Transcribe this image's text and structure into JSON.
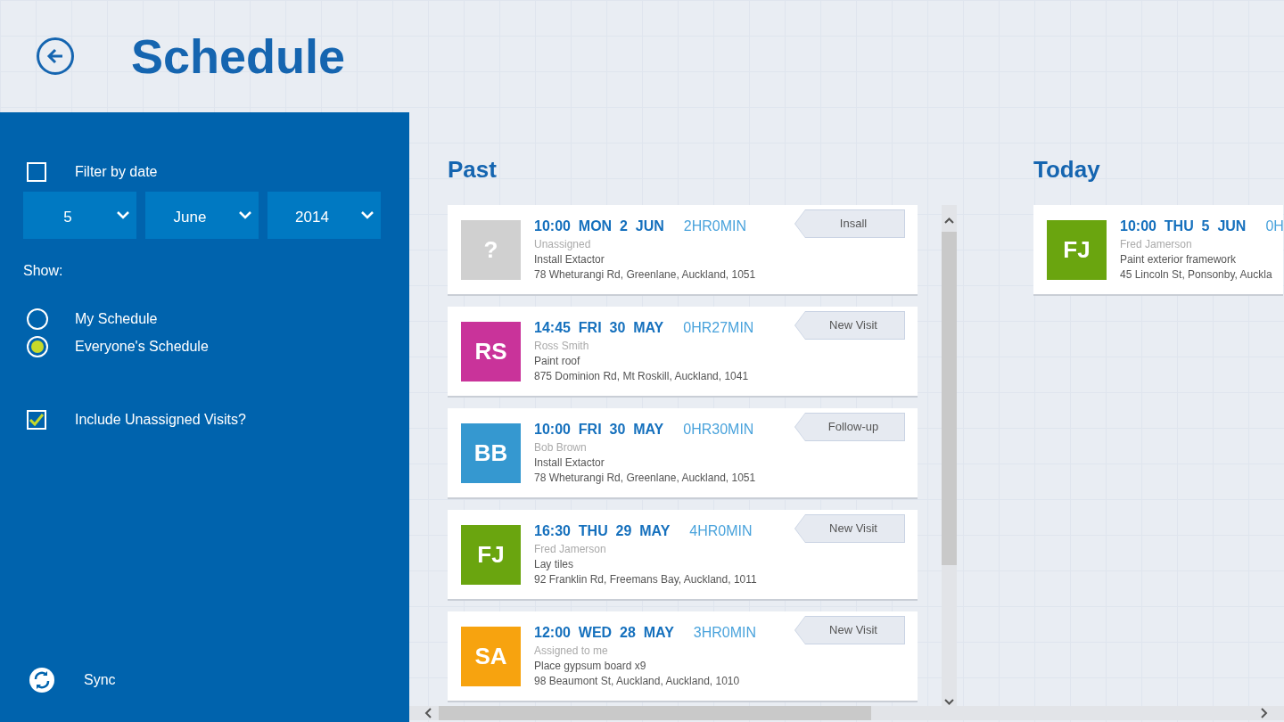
{
  "header": {
    "title": "Schedule"
  },
  "sidebar": {
    "filter_by_date": {
      "label": "Filter by date",
      "checked": false
    },
    "date_selects": [
      {
        "value": "5"
      },
      {
        "value": "June"
      },
      {
        "value": "2014"
      }
    ],
    "show_label": "Show:",
    "show_options": [
      {
        "label": "My Schedule",
        "selected": false
      },
      {
        "label": "Everyone's Schedule",
        "selected": true
      }
    ],
    "include_unassigned": {
      "label": "Include Unassigned Visits?",
      "checked": true
    },
    "sync": {
      "label": "Sync"
    }
  },
  "columns": [
    {
      "title": "Past",
      "visits": [
        {
          "initials": "?",
          "color": "#d0d0d0",
          "time": "10:00  MON  2  JUN",
          "duration": "2HR0MIN",
          "assignee": "Unassigned",
          "task": "Install Extactor",
          "address": "78 Wheturangi Rd, Greenlane, Auckland, 1051",
          "tag": "Insall"
        },
        {
          "initials": "RS",
          "color": "#c9339a",
          "time": "14:45  FRI  30  MAY",
          "duration": "0HR27MIN",
          "assignee": "Ross Smith",
          "task": "Paint roof",
          "address": "875 Dominion Rd, Mt Roskill, Auckland, 1041",
          "tag": "New Visit"
        },
        {
          "initials": "BB",
          "color": "#3598d0",
          "time": "10:00  FRI  30  MAY",
          "duration": "0HR30MIN",
          "assignee": "Bob Brown",
          "task": "Install Extactor",
          "address": "78 Wheturangi Rd, Greenlane, Auckland, 1051",
          "tag": "Follow-up"
        },
        {
          "initials": "FJ",
          "color": "#6aa50f",
          "time": "16:30  THU  29  MAY",
          "duration": "4HR0MIN",
          "assignee": "Fred Jamerson",
          "task": "Lay tiles",
          "address": "92 Franklin Rd, Freemans Bay, Auckland, 1011",
          "tag": "New Visit"
        },
        {
          "initials": "SA",
          "color": "#f7a30f",
          "time": "12:00  WED  28  MAY",
          "duration": "3HR0MIN",
          "assignee": "Assigned to me",
          "task": "Place gypsum board x9",
          "address": "98 Beaumont St, Auckland, Auckland, 1010",
          "tag": "New Visit"
        }
      ]
    },
    {
      "title": "Today",
      "visits": [
        {
          "initials": "FJ",
          "color": "#6aa50f",
          "time": "10:00  THU  5  JUN",
          "duration": "0H",
          "assignee": "Fred Jamerson",
          "task": "Paint exterior framework",
          "address": "45 Lincoln St, Ponsonby, Auckla"
        }
      ]
    }
  ]
}
